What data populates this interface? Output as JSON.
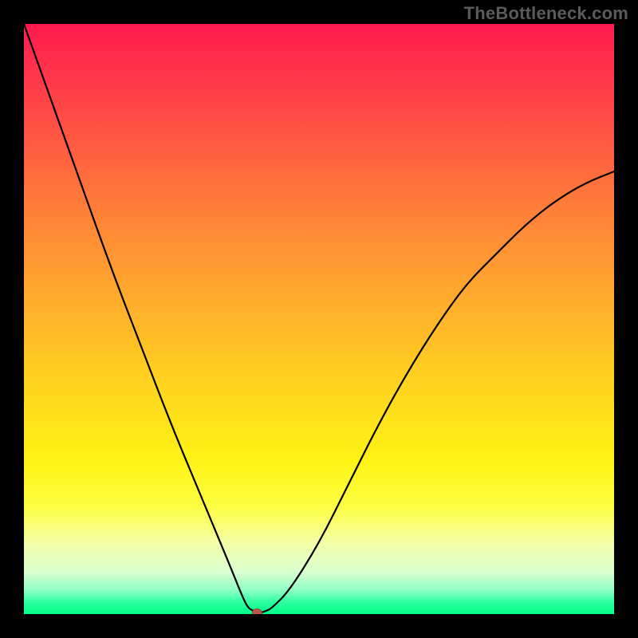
{
  "watermark": "TheBottleneck.com",
  "chart_data": {
    "type": "line",
    "title": "",
    "xlabel": "",
    "ylabel": "",
    "xlim": [
      0,
      100
    ],
    "ylim": [
      0,
      100
    ],
    "grid": false,
    "background_gradient": {
      "from": "#ff1a4e",
      "to": "#00ff88",
      "direction": "top-to-bottom"
    },
    "series": [
      {
        "name": "bottleneck-curve",
        "x": [
          0,
          5,
          10,
          15,
          20,
          25,
          30,
          35,
          37,
          38,
          39,
          40,
          41,
          42,
          45,
          50,
          55,
          60,
          65,
          70,
          75,
          80,
          85,
          90,
          95,
          100
        ],
        "y": [
          100,
          86,
          72,
          58,
          45,
          32,
          20,
          8,
          3,
          1,
          0.5,
          0.2,
          0.5,
          1,
          4,
          12,
          22,
          32,
          41,
          49,
          56,
          61,
          66,
          70,
          73,
          75
        ]
      }
    ],
    "annotations": [
      {
        "type": "point",
        "name": "minimum-marker",
        "x": 39.5,
        "y": 0.2,
        "color": "#b85a4a"
      }
    ]
  }
}
